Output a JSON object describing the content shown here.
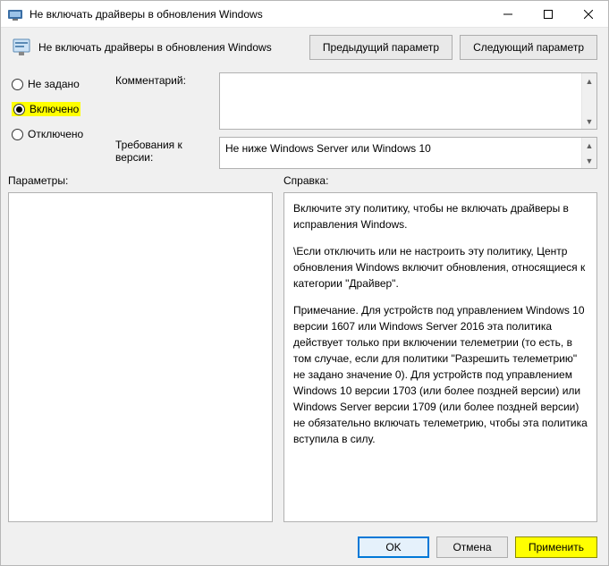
{
  "window": {
    "title": "Не включать драйверы в обновления Windows"
  },
  "header": {
    "title": "Не включать драйверы в обновления Windows",
    "prev_label": "Предыдущий параметр",
    "next_label": "Следующий параметр"
  },
  "radios": {
    "not_configured": "Не задано",
    "enabled": "Включено",
    "disabled": "Отключено",
    "selected": "enabled"
  },
  "fields": {
    "comment_label": "Комментарий:",
    "comment_value": "",
    "requirements_label": "Требования к версии:",
    "requirements_value": "Не ниже Windows Server или Windows 10"
  },
  "lower": {
    "params_label": "Параметры:",
    "help_label": "Справка:"
  },
  "help": {
    "p1": "Включите эту политику, чтобы не включать драйверы в исправления Windows.",
    "p2": "\\Если отключить или не настроить эту политику, Центр обновления Windows включит обновления, относящиеся к категории \"Драйвер\".",
    "p3": "Примечание. Для устройств под управлением Windows 10 версии 1607 или Windows Server 2016 эта политика действует только при включении телеметрии (то есть, в том случае, если для политики \"Разрешить телеметрию\" не задано значение 0). Для устройств под управлением Windows 10 версии 1703 (или более поздней версии) или Windows Server версии 1709 (или более поздней версии) не обязательно включать телеметрию, чтобы эта политика вступила в силу."
  },
  "footer": {
    "ok": "OK",
    "cancel": "Отмена",
    "apply": "Применить"
  }
}
